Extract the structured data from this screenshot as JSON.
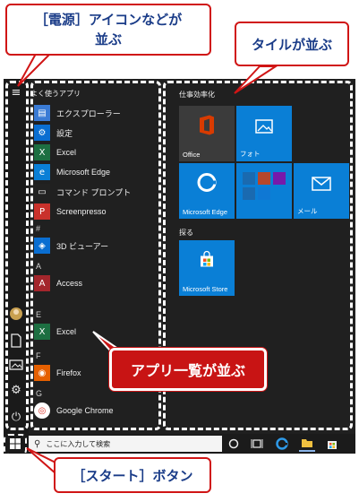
{
  "callouts": {
    "power_icons": "［電源］アイコンなどが\n並ぶ",
    "tiles": "タイルが並ぶ",
    "app_list": "アプリ一覧が並ぶ",
    "start_button": "［スタート］ボタン"
  },
  "app_list": {
    "section_title": "よく使うアプリ",
    "frequent": [
      {
        "label": "エクスプローラー",
        "icon": "file-explorer-icon",
        "color": "#3a7bd5"
      },
      {
        "label": "設定",
        "icon": "settings-gear-icon",
        "color": "#0a6ed1"
      },
      {
        "label": "Excel",
        "icon": "excel-icon",
        "color": "#1d6f42"
      },
      {
        "label": "Microsoft Edge",
        "icon": "edge-icon",
        "color": "#0a7fd6"
      },
      {
        "label": "コマンド プロンプト",
        "icon": "command-prompt-icon",
        "color": "#222222"
      },
      {
        "label": "Screenpresso",
        "icon": "screenpresso-icon",
        "color": "#c9312b"
      }
    ],
    "groups": [
      {
        "letter": "#",
        "apps": [
          {
            "label": "3D ビューアー",
            "icon": "3d-viewer-icon",
            "color": "#0a6ed1"
          }
        ]
      },
      {
        "letter": "A",
        "apps": [
          {
            "label": "Access",
            "icon": "access-icon",
            "color": "#a4262c"
          }
        ]
      },
      {
        "letter": "E",
        "apps": [
          {
            "label": "Excel",
            "icon": "excel-icon",
            "color": "#1d6f42"
          }
        ]
      },
      {
        "letter": "F",
        "apps": [
          {
            "label": "Firefox",
            "icon": "firefox-icon",
            "color": "#e66000"
          }
        ]
      },
      {
        "letter": "G",
        "apps": [
          {
            "label": "Google Chrome",
            "icon": "chrome-icon",
            "color": "#ffffff"
          }
        ]
      }
    ]
  },
  "tiles": {
    "group1_title": "仕事効率化",
    "group2_title": "探る",
    "items": [
      {
        "label": "Office",
        "icon": "office-icon",
        "color": "#3b3b3b"
      },
      {
        "label": "フォト",
        "icon": "photos-icon",
        "color": "#0a7fd6"
      },
      {
        "label": "Microsoft Edge",
        "icon": "edge-icon",
        "color": "#0a7fd6"
      },
      {
        "label": "",
        "icon": "office-apps-folder-icon",
        "color": "#0a7fd6"
      },
      {
        "label": "メール",
        "icon": "mail-icon",
        "color": "#0a7fd6"
      },
      {
        "label": "Microsoft Store",
        "icon": "store-icon",
        "color": "#0a7fd6"
      }
    ]
  },
  "taskbar": {
    "search_placeholder": "ここに入力して検索",
    "icons": [
      "start-windows-icon",
      "search-icon",
      "cortana-icon",
      "task-view-icon",
      "edge-icon",
      "file-explorer-icon",
      "store-icon"
    ]
  },
  "rail_icons": [
    "hamburger-menu-icon",
    "user-avatar-icon",
    "document-icon",
    "pictures-icon",
    "settings-icon",
    "power-icon"
  ]
}
